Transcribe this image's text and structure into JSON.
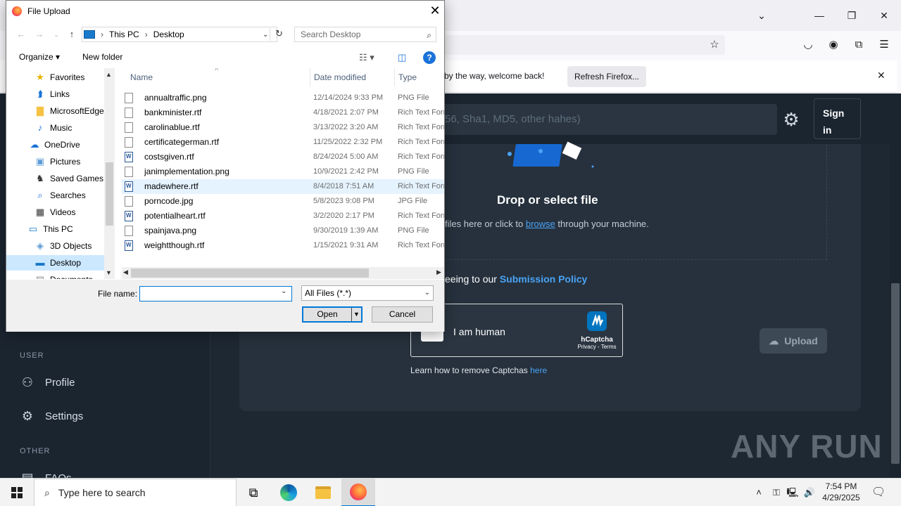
{
  "browser": {
    "notice_text": "Fixed by the way, welcome back!",
    "notice_visible_text": "d by the way, welcome back!",
    "refresh_label": "Refresh Firefox...",
    "icons": [
      "star-icon",
      "pocket-icon",
      "account-icon",
      "extensions-icon",
      "menu-icon"
    ]
  },
  "webpage": {
    "search_placeholder_visible": "56, Sha1, MD5, other hahes)",
    "sign_in_label": "Sign in",
    "drop_title": "Drop or select file",
    "drop_sub_prefix": "files here or click to ",
    "drop_sub_link": "browse",
    "drop_sub_suffix": " through your machine.",
    "agree_prefix": "eeing to our ",
    "agree_link": "Submission Policy",
    "captcha_label": "I am human",
    "captcha_brand": "hCaptcha",
    "captcha_links": "Privacy - Terms",
    "captcha_help_prefix": "Learn how to remove Captchas ",
    "captcha_help_link": "here",
    "upload_label": "Upload",
    "sidebar": {
      "section_user": "USER",
      "profile": "Profile",
      "settings": "Settings",
      "section_other": "OTHER",
      "faqs_partial": "FAQs"
    },
    "watermark": "ANY RUN"
  },
  "dialog": {
    "title": "File Upload",
    "breadcrumb": [
      "This PC",
      "Desktop"
    ],
    "search_placeholder": "Search Desktop",
    "organize_label": "Organize ▾",
    "new_folder_label": "New folder",
    "nav_items": [
      {
        "label": "Favorites",
        "icon": "star-icon",
        "color": "#e8b400"
      },
      {
        "label": "Links",
        "icon": "link-icon",
        "color": "#1a73d9"
      },
      {
        "label": "MicrosoftEdge",
        "icon": "folder-icon",
        "color": "#f5c242"
      },
      {
        "label": "Music",
        "icon": "music-icon",
        "color": "#1a73d9"
      },
      {
        "label": "OneDrive",
        "icon": "cloud-icon",
        "color": "#1a73d9"
      },
      {
        "label": "Pictures",
        "icon": "pictures-icon",
        "color": "#5b9bd5"
      },
      {
        "label": "Saved Games",
        "icon": "games-icon",
        "color": "#333333"
      },
      {
        "label": "Searches",
        "icon": "search-icon",
        "color": "#1a73d9"
      },
      {
        "label": "Videos",
        "icon": "video-icon",
        "color": "#333333"
      },
      {
        "label": "This PC",
        "icon": "computer-icon",
        "color": "#1979ca"
      },
      {
        "label": "3D Objects",
        "icon": "cube-icon",
        "color": "#5b9bd5"
      },
      {
        "label": "Desktop",
        "icon": "desktop-icon",
        "color": "#1979ca"
      },
      {
        "label": "Documents",
        "icon": "documents-icon",
        "color": "#888888"
      }
    ],
    "columns": {
      "name": "Name",
      "date": "Date modified",
      "type": "Type"
    },
    "files": [
      {
        "name": "annualtraffic.png",
        "date": "12/14/2024 9:33 PM",
        "type": "PNG File",
        "kind": "img"
      },
      {
        "name": "bankminister.rtf",
        "date": "4/18/2021 2:07 PM",
        "type": "Rich Text Format",
        "kind": "doc"
      },
      {
        "name": "carolinablue.rtf",
        "date": "3/13/2022 3:20 AM",
        "type": "Rich Text Format",
        "kind": "doc"
      },
      {
        "name": "certificategerman.rtf",
        "date": "11/25/2022 2:32 PM",
        "type": "Rich Text Format",
        "kind": "doc"
      },
      {
        "name": "costsgiven.rtf",
        "date": "8/24/2024 5:00 AM",
        "type": "Rich Text Format",
        "kind": "rtf"
      },
      {
        "name": "janimplementation.png",
        "date": "10/9/2021 2:42 PM",
        "type": "PNG File",
        "kind": "img"
      },
      {
        "name": "madewhere.rtf",
        "date": "8/4/2018 7:51 AM",
        "type": "Rich Text Format",
        "kind": "rtf"
      },
      {
        "name": "porncode.jpg",
        "date": "5/8/2023 9:08 PM",
        "type": "JPG File",
        "kind": "img"
      },
      {
        "name": "potentialheart.rtf",
        "date": "3/2/2020 2:17 PM",
        "type": "Rich Text Format",
        "kind": "rtf"
      },
      {
        "name": "spainjava.png",
        "date": "9/30/2019 1:39 AM",
        "type": "PNG File",
        "kind": "img"
      },
      {
        "name": "weightthough.rtf",
        "date": "1/15/2021 9:31 AM",
        "type": "Rich Text Format",
        "kind": "rtf"
      }
    ],
    "highlighted_file": "madewhere.rtf",
    "file_name_label": "File name:",
    "file_name_value": "",
    "file_type_value": "All Files (*.*)",
    "open_label": "Open",
    "cancel_label": "Cancel"
  },
  "taskbar": {
    "search_placeholder": "Type here to search",
    "time": "7:54 PM",
    "date": "4/29/2025"
  }
}
